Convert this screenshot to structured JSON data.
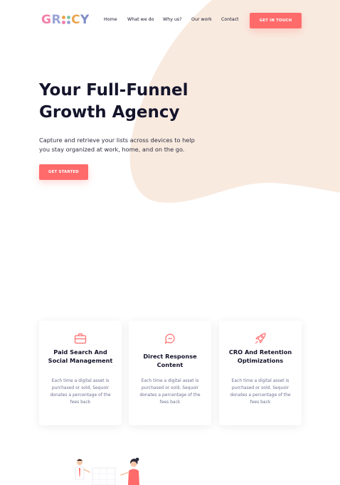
{
  "brand": {
    "logo_text": "GROCY",
    "colors": {
      "accent": "#ff6b6b",
      "blob": "#f9eadf",
      "heading": "#14142b",
      "muted": "#6e7191"
    }
  },
  "nav": {
    "items": [
      {
        "label": "Home"
      },
      {
        "label": "What we do"
      },
      {
        "label": "Why us?"
      },
      {
        "label": "Our work"
      },
      {
        "label": "Contact"
      }
    ],
    "cta_label": "GET IN TOUCH"
  },
  "hero": {
    "title_line1": "Your Full-Funnel",
    "title_line2": "Growth Agency",
    "subtitle": "Capture and retrieve your lists across devices to help you stay organized at work, home, and on the go.",
    "cta_label": "GET STARTED"
  },
  "services": [
    {
      "icon": "briefcase-icon",
      "title": "Paid Search And Social Management",
      "desc": "Each time a digital asset is purchased or sold, Sequoir donates a percentage of the fees back"
    },
    {
      "icon": "chat-icon",
      "title": "Direct Response Content",
      "desc": "Each time a digital asset is purchased or sold, Sequoir donates a percentage of the fees back"
    },
    {
      "icon": "rocket-icon",
      "title": "CRO And Retention Optimizations",
      "desc": "Each time a digital asset is purchased or sold, Sequoir donates a percentage of the fees back"
    }
  ]
}
